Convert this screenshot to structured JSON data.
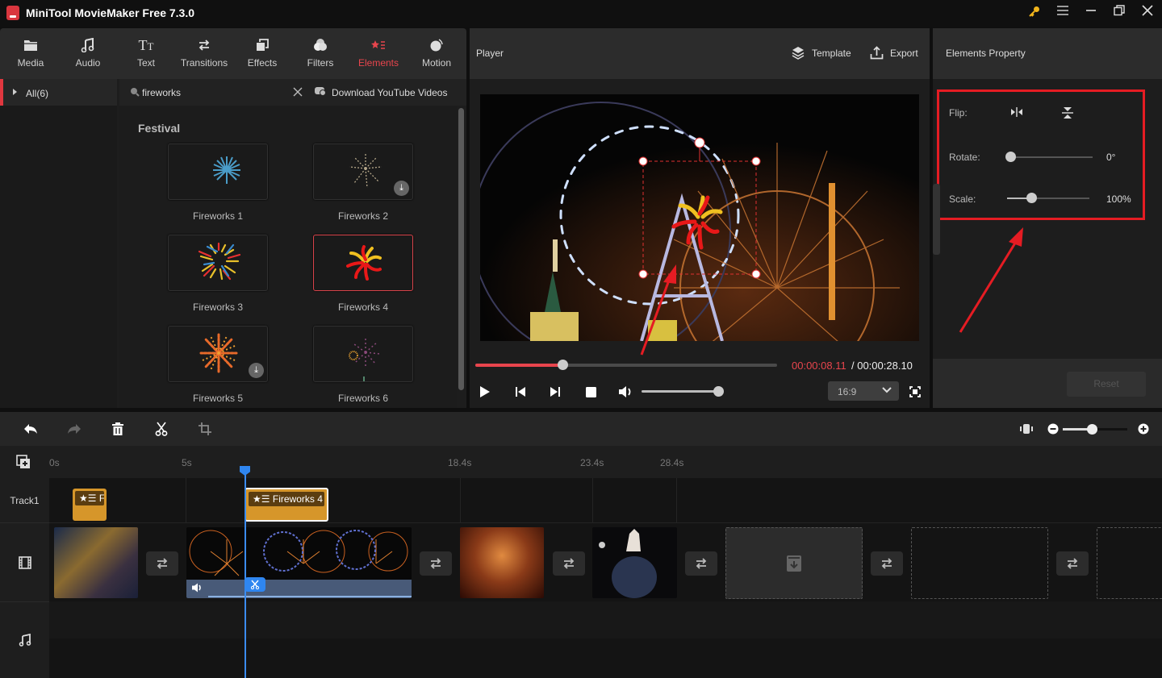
{
  "app": {
    "title": "MiniTool MovieMaker Free 7.3.0",
    "window_buttons": [
      "key-icon",
      "menu-icon",
      "minimize-icon",
      "restore-icon",
      "close-icon"
    ]
  },
  "toolbox": {
    "tabs": [
      {
        "label": "Media",
        "icon": "folder-icon"
      },
      {
        "label": "Audio",
        "icon": "music-note-icon"
      },
      {
        "label": "Text",
        "icon": "text-icon"
      },
      {
        "label": "Transitions",
        "icon": "swap-icon"
      },
      {
        "label": "Effects",
        "icon": "effects-icon"
      },
      {
        "label": "Filters",
        "icon": "filters-icon"
      },
      {
        "label": "Elements",
        "icon": "elements-icon",
        "active": true
      },
      {
        "label": "Motion",
        "icon": "motion-icon"
      }
    ],
    "accent": "#e8454d"
  },
  "library": {
    "category": "All(6)",
    "search_value": "fireworks",
    "download_label": "Download YouTube Videos",
    "section_title": "Festival",
    "items": [
      {
        "label": "Fireworks 1",
        "downloaded": true,
        "selected": false
      },
      {
        "label": "Fireworks 2",
        "downloaded": false,
        "selected": false
      },
      {
        "label": "Fireworks 3",
        "downloaded": true,
        "selected": false
      },
      {
        "label": "Fireworks 4",
        "downloaded": true,
        "selected": true
      },
      {
        "label": "Fireworks 5",
        "downloaded": false,
        "selected": false
      },
      {
        "label": "Fireworks 6",
        "downloaded": true,
        "selected": false
      }
    ]
  },
  "player": {
    "title": "Player",
    "template_label": "Template",
    "export_label": "Export",
    "current_time": "00:00:08.11",
    "total_time": "/ 00:00:28.10",
    "progress_fraction": 0.29,
    "volume_fraction": 1.0,
    "aspect_ratio": "16:9"
  },
  "properties": {
    "title": "Elements Property",
    "flip_label": "Flip:",
    "rotate_label": "Rotate:",
    "rotate_value": "0°",
    "rotate_fraction": 0.0,
    "scale_label": "Scale:",
    "scale_value": "100%",
    "scale_fraction": 0.29,
    "reset_label": "Reset",
    "highlight_color": "#e51c23"
  },
  "timeline": {
    "zoom_fraction": 0.45,
    "ruler_ticks": [
      "0s",
      "5s",
      "18.4s",
      "23.4s",
      "28.4s"
    ],
    "track_label": "Track1",
    "element_clips": [
      {
        "label": "Fi"
      },
      {
        "label": "Fireworks 4",
        "selected": true
      }
    ],
    "video_clips": [
      "aerial-city-night",
      "ferris-wheel-night",
      "lanterns",
      "sky-lantern"
    ],
    "empty_slots": 3
  }
}
